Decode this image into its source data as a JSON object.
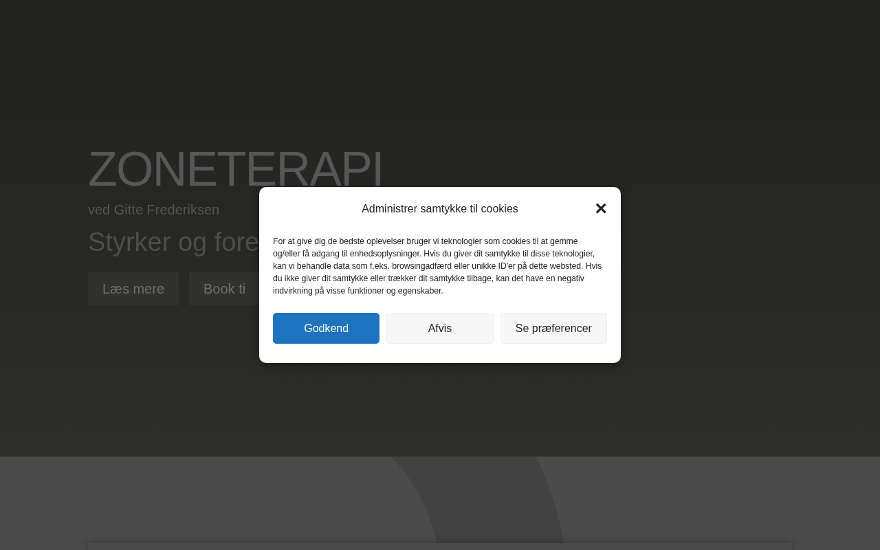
{
  "hero": {
    "title": "ZONETERAPI",
    "subtitle": "ved Gitte Frederiksen",
    "tagline": "Styrker og fore",
    "buttons": [
      {
        "label": "Læs mere"
      },
      {
        "label": "Book ti"
      }
    ]
  },
  "cookie_dialog": {
    "title": "Administrer samtykke til cookies",
    "close": "×",
    "text": "For at give dig de bedste oplevelser bruger vi teknologier som cookies til at gemme og/eller få adgang til enhedsoplysninger. Hvis du giver dit samtykke til disse teknologier, kan vi behandle data som f.eks. browsingadfærd eller unikke ID'er på dette websted. Hvis du ikke giver dit samtykke eller trækker dit samtykke tilbage, kan det have en negativ indvirkning på visse funktioner og egenskaber.",
    "buttons": [
      {
        "label": "Godkend",
        "kind": "primary"
      },
      {
        "label": "Afvis",
        "kind": "secondary"
      },
      {
        "label": "Se præferencer",
        "kind": "secondary"
      }
    ]
  }
}
